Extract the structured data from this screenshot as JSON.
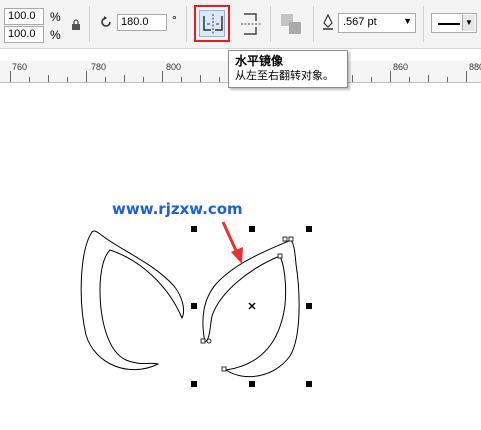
{
  "toolbar": {
    "scale_x": "100.0",
    "scale_y": "100.0",
    "percent_symbol": "%",
    "rotation_value": "180.0",
    "degree_symbol": "°",
    "outline_width": ".567 pt"
  },
  "tooltip": {
    "title": "水平镜像",
    "description": "从左至右翻转对象。"
  },
  "ruler": {
    "labels": [
      "760",
      "780",
      "800",
      "820",
      "840",
      "860",
      "880"
    ]
  },
  "canvas": {
    "watermark": "www.rjzxw.com"
  },
  "colors": {
    "highlight_box": "#e02020",
    "arrow": "#e8322f",
    "watermark": "#1f5fd6"
  },
  "icons": [
    "lock-icon",
    "rotate-icon",
    "mirror-horizontal-icon",
    "mirror-vertical-icon",
    "align-icon",
    "pen-nib-icon",
    "line-style-icon"
  ]
}
